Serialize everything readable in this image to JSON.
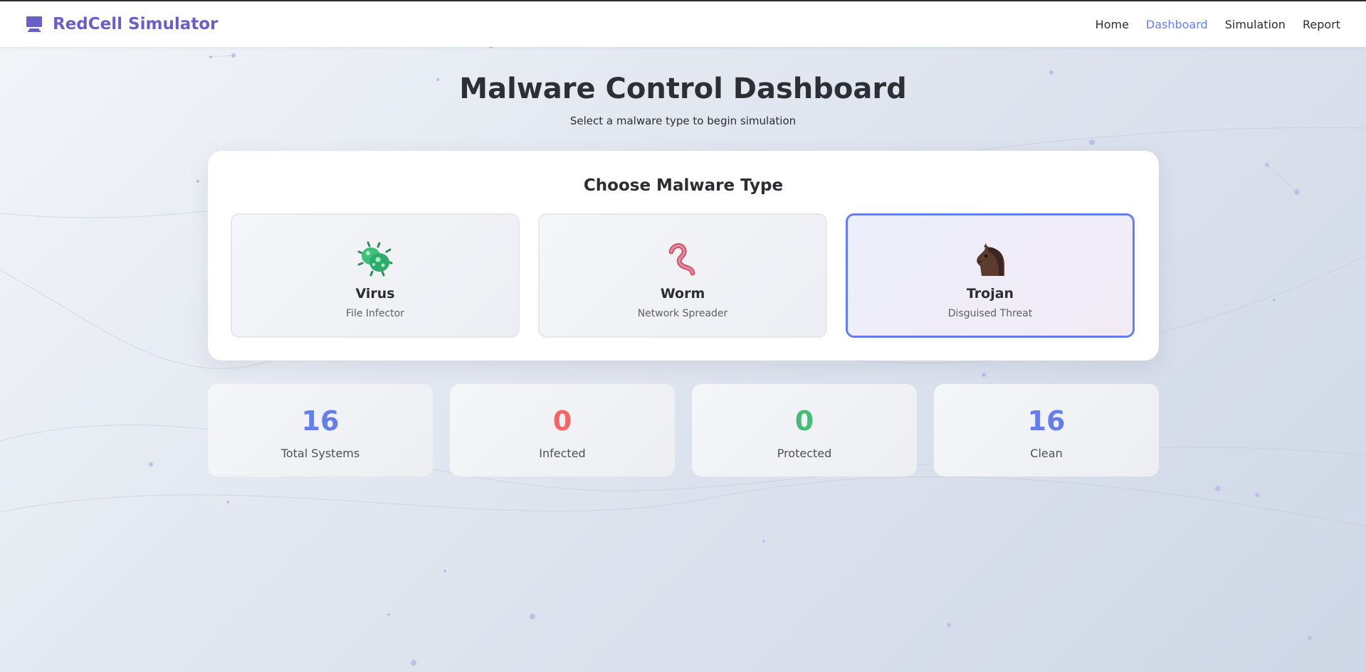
{
  "app": {
    "name": "RedCell Simulator"
  },
  "nav": {
    "items": [
      {
        "label": "Home",
        "active": false
      },
      {
        "label": "Dashboard",
        "active": true
      },
      {
        "label": "Simulation",
        "active": false
      },
      {
        "label": "Report",
        "active": false
      }
    ]
  },
  "main": {
    "title": "Malware Control Dashboard",
    "subtitle": "Select a malware type to begin simulation",
    "panel_title": "Choose Malware Type",
    "malware_types": [
      {
        "name": "Virus",
        "desc": "File Infector",
        "icon": "virus-icon",
        "selected": false
      },
      {
        "name": "Worm",
        "desc": "Network Spreader",
        "icon": "worm-icon",
        "selected": false
      },
      {
        "name": "Trojan",
        "desc": "Disguised Threat",
        "icon": "horse-icon",
        "selected": true
      }
    ],
    "stats": [
      {
        "value": "16",
        "label": "Total Systems",
        "color": "#667eea"
      },
      {
        "value": "0",
        "label": "Infected",
        "color": "#f56565"
      },
      {
        "value": "0",
        "label": "Protected",
        "color": "#48bb78"
      },
      {
        "value": "16",
        "label": "Clean",
        "color": "#667eea"
      }
    ]
  },
  "colors": {
    "accent": "#667eea",
    "brand": "#6a5fc4"
  }
}
